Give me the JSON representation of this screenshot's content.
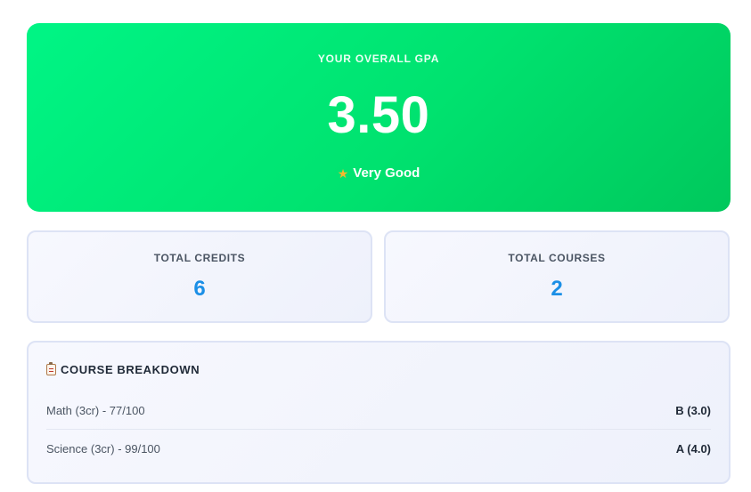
{
  "gpa": {
    "label": "YOUR OVERALL GPA",
    "value": "3.50",
    "rating": "Very Good",
    "rating_icon": "star-icon"
  },
  "stats": [
    {
      "label": "TOTAL CREDITS",
      "value": "6"
    },
    {
      "label": "TOTAL COURSES",
      "value": "2"
    }
  ],
  "breakdown": {
    "title": "COURSE BREAKDOWN",
    "title_icon": "clipboard-icon",
    "courses": [
      {
        "name": "Math (3cr) - 77/100",
        "grade": "B (3.0)"
      },
      {
        "name": "Science (3cr) - 99/100",
        "grade": "A (4.0)"
      }
    ]
  },
  "colors": {
    "gpa_gradient_start": "#00f585",
    "gpa_gradient_end": "#00c85c",
    "stat_value": "#1b8fe6",
    "star": "#f5b82e"
  }
}
